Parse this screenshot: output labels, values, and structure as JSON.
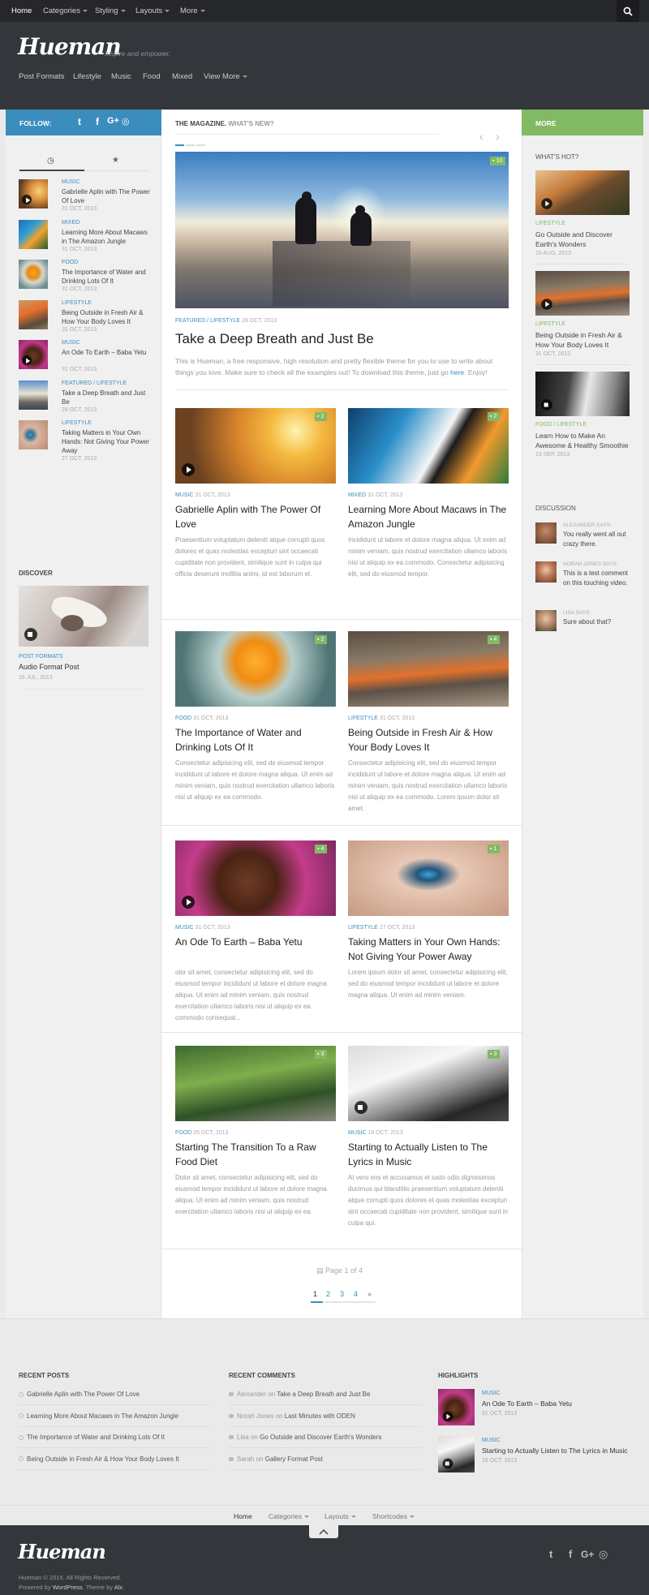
{
  "topnav": {
    "items": [
      {
        "label": "Home"
      },
      {
        "label": "Categories"
      },
      {
        "label": "Styling"
      },
      {
        "label": "Layouts"
      },
      {
        "label": "More"
      }
    ],
    "search_icon": "search-icon"
  },
  "header": {
    "logo": "Hueman",
    "tagline": "Inspire and empower."
  },
  "subnav": {
    "items": [
      {
        "label": "Post Formats"
      },
      {
        "label": "Lifestyle"
      },
      {
        "label": "Music"
      },
      {
        "label": "Food"
      },
      {
        "label": "Mixed"
      },
      {
        "label": "View More"
      }
    ]
  },
  "left_bar": {
    "follow": "FOLLOW:"
  },
  "main_bar": {
    "title": "THE MAGAZINE.",
    "subtitle": "WHAT'S NEW?"
  },
  "right_bar": {
    "title": "MORE"
  },
  "left_tabs": {
    "recent_icon": "clock-icon",
    "popular_icon": "star-icon"
  },
  "left_posts": [
    {
      "category": "MUSIC",
      "title": "Gabrielle Aplin with The Power Of Love",
      "date": "31 OCT, 2013",
      "media": "play"
    },
    {
      "category": "MIXED",
      "title": "Learning More About Macaws in The Amazon Jungle",
      "date": "31 OCT, 2013",
      "media": ""
    },
    {
      "category": "FOOD",
      "title": "The Importance of Water and Drinking Lots Of It",
      "date": "31 OCT, 2013",
      "media": ""
    },
    {
      "category": "LIFESTYLE",
      "title": "Being Outside in Fresh Air & How Your Body Loves It",
      "date": "31 OCT, 2013",
      "media": ""
    },
    {
      "category": "MUSIC",
      "title": "An Ode To Earth – Baba Yetu",
      "date": "31 OCT, 2013",
      "media": "play"
    },
    {
      "category": "FEATURED / LIFESTYLE",
      "title": "Take a Deep Breath and Just Be",
      "date": "28 OCT, 2013",
      "media": ""
    },
    {
      "category": "LIFESTYLE",
      "title": "Taking Matters in Your Own Hands: Not Giving Your Power Away",
      "date": "27 OCT, 2013",
      "media": ""
    }
  ],
  "discover": {
    "heading": "DISCOVER",
    "category": "POST FORMATS",
    "title": "Audio Format Post",
    "date": "16 JUL, 2013"
  },
  "featured": {
    "comments": "10",
    "category1": "FEATURED",
    "category2": "LIFESTYLE",
    "date": "28 OCT, 2013",
    "title": "Take a Deep Breath and Just Be",
    "excerpt_start": "This is Hueman, a free responsive, high resolution and pretty flexible theme for you to use to write about things you love. Make sure to check all the examples out! To download this theme, just go",
    "excerpt_link": "here",
    "excerpt_end": ". Enjoy!"
  },
  "grid_posts": [
    {
      "category": "MUSIC",
      "date": "31 OCT, 2013",
      "title": "Gabrielle Aplin with The Power Of Love",
      "comments": "2",
      "media": "play",
      "excerpt": "Praesentium voluptatum deleniti atque corrupti quos dolores et quas molestias excepturi sint occaecati cupiditate non provident, similique sunt in culpa qui officia deserunt mollitia animi, id est laborum et."
    },
    {
      "category": "MIXED",
      "date": "31 OCT, 2013",
      "title": "Learning More About Macaws in The Amazon Jungle",
      "comments": "2",
      "media": "",
      "excerpt": "Incididunt ut labore et dolore magna aliqua. Ut enim ad minim veniam, quis nostrud exercitation ullamco laboris nisi ut aliquip ex ea commodo. Consectetur adipisicing elit, sed do eiusmod tempor."
    },
    {
      "category": "FOOD",
      "date": "31 OCT, 2013",
      "title": "The Importance of Water and Drinking Lots Of It",
      "comments": "2",
      "media": "",
      "excerpt": "Consectetur adipisicing elit, sed do eiusmod tempor incididunt ut labore et dolore magna aliqua. Ut enim ad minim veniam, quis nostrud exercitation ullamco laboris nisi ut aliquip ex ea commodo."
    },
    {
      "category": "LIFESTYLE",
      "date": "31 OCT, 2013",
      "title": "Being Outside in Fresh Air & How Your Body Loves It",
      "comments": "4",
      "media": "",
      "excerpt": "Consectetur adipisicing elit, sed do eiusmod tempor incididunt ut labore et dolore magna aliqua. Ut enim ad minim veniam, quis nostrud exercitation ullamco laboris nisi ut aliquip ex ea commodo. Lorem ipsum dolor sit amet."
    },
    {
      "category": "MUSIC",
      "date": "31 OCT, 2013",
      "title": "An Ode To Earth – Baba Yetu",
      "comments": "4",
      "media": "play",
      "excerpt": "olor sit amet, consectetur adipisicing elit, sed do eiusmod tempor incididunt ut labore et dolore magna aliqua. Ut enim ad minim veniam, quis nostrud exercitation ullamco laboris nisi ut aliquip ex ea commodo consequat..."
    },
    {
      "category": "LIFESTYLE",
      "date": "27 OCT, 2013",
      "title": "Taking Matters in Your Own Hands: Not Giving Your Power Away",
      "comments": "1",
      "media": "",
      "excerpt": "Lorem ipsum dolor sit amet, consectetur adipisicing elit, sed do eiusmod tempor incididunt ut labore et dolore magna aliqua. Ut enim ad minim veniam."
    },
    {
      "category": "FOOD",
      "date": "25 OCT, 2013",
      "title": "Starting The Transition To a Raw Food Diet",
      "comments": "3",
      "media": "",
      "excerpt": "Dolor sit amet, consectetur adipisicing elit, sed do eiusmod tempor incididunt ut labore et dolore magna aliqua. Ut enim ad minim veniam, quis nostrud exercitation ullamco laboris nisi ut aliquip ex ea."
    },
    {
      "category": "MUSIC",
      "date": "16 OCT, 2013",
      "title": "Starting to Actually Listen to The Lyrics in Music",
      "comments": "3",
      "media": "sound",
      "excerpt": "At vero eos et accusamus et iusto odio dignissimos ducimus qui blanditiis praesentium voluptatum deleniti atque corrupti quos dolores et quas molestias excepturi sint occaecati cupiditate non provident, similique sunt in culpa qui."
    }
  ],
  "pagination": {
    "label": "Page 1 of 4",
    "pages": [
      "1",
      "2",
      "3",
      "4",
      "»"
    ]
  },
  "right_hot": {
    "heading": "WHAT'S HOT?",
    "posts": [
      {
        "category": "LIFESTYLE",
        "title": "Go Outside and Discover Earth's Wonders",
        "date": "15 AUG, 2013"
      },
      {
        "category": "LIFESTYLE",
        "title": "Being Outside in Fresh Air & How Your Body Loves It",
        "date": "31 OCT, 2013"
      },
      {
        "category": "FOOD / LIFESTYLE",
        "title": "Learn How to Make An Awesome & Healthy Smoothie",
        "date": "13 SEP, 2013"
      }
    ]
  },
  "right_discussion": {
    "heading": "DISCUSSION",
    "comments": [
      {
        "author": "ALEXANDER SAYS:",
        "text": "You really went all out crazy there."
      },
      {
        "author": "NORAH JONES SAYS:",
        "text": "This is a test comment on this touching video."
      },
      {
        "author": "LISA SAYS:",
        "text": "Sure about that?"
      }
    ]
  },
  "footer": {
    "recent_posts": {
      "heading": "RECENT POSTS",
      "items": [
        "Gabrielle Aplin with The Power Of Love",
        "Learning More About Macaws in The Amazon Jungle",
        "The Importance of Water and Drinking Lots Of It",
        "Being Outside in Fresh Air & How Your Body Loves It"
      ]
    },
    "recent_comments": {
      "heading": "RECENT COMMENTS",
      "items": [
        {
          "author": "Alexander",
          "on": "on",
          "post": "Take a Deep Breath and Just Be"
        },
        {
          "author": "Norah Jones",
          "on": "on",
          "post": "Last Minutes with ODEN"
        },
        {
          "author": "Lisa",
          "on": "on",
          "post": "Go Outside and Discover Earth's Wonders"
        },
        {
          "author": "Sarah",
          "on": "on",
          "post": "Gallery Format Post"
        }
      ]
    },
    "highlights": {
      "heading": "HIGHLIGHTS",
      "items": [
        {
          "category": "MUSIC",
          "title": "An Ode To Earth – Baba Yetu",
          "date": "31 OCT, 2013"
        },
        {
          "category": "MUSIC",
          "title": "Starting to Actually Listen to The Lyrics in Music",
          "date": "16 OCT, 2013"
        }
      ]
    },
    "nav": [
      {
        "label": "Home"
      },
      {
        "label": "Categories"
      },
      {
        "label": "Layouts"
      },
      {
        "label": "Shortcodes"
      }
    ],
    "logo": "Hueman",
    "copyright": "Hueman © 2015. All Rights Reserved.",
    "powered_prefix": "Powered by",
    "powered_wp": "WordPress",
    "theme_prefix": ". Theme by",
    "theme_author": "Alx",
    "theme_suffix": "."
  },
  "colors": {
    "accent_blue": "#3b8dbd",
    "accent_green": "#82b965",
    "dark": "#33363b",
    "topbar": "#26272b"
  }
}
